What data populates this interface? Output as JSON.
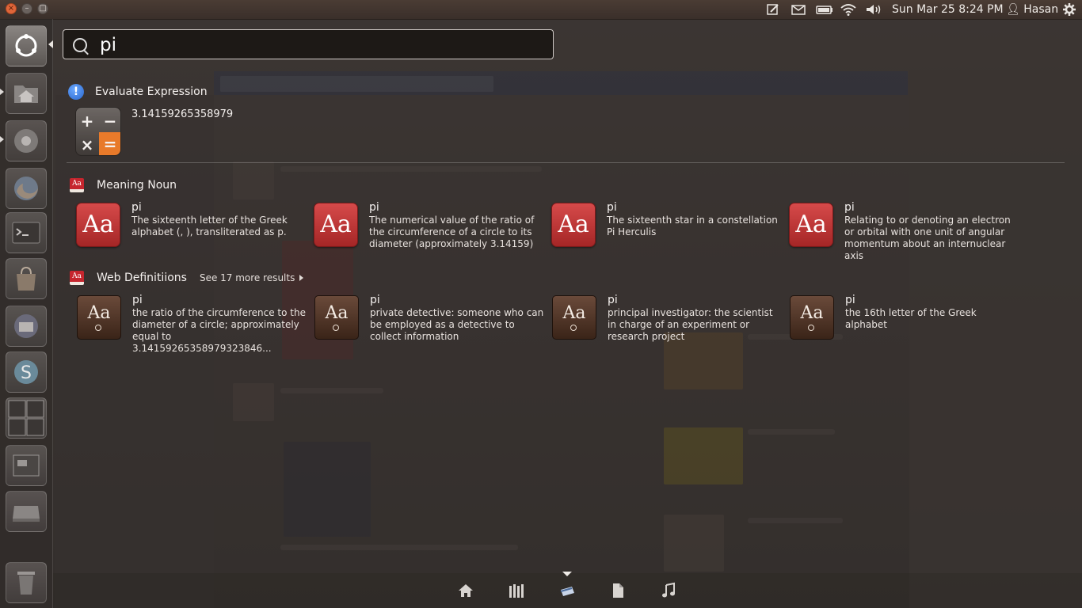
{
  "panel": {
    "clock": "Sun Mar 25  8:24 PM",
    "user": "Hasan"
  },
  "search": {
    "query": "pi"
  },
  "groups": {
    "evaluate": {
      "title": "Evaluate Expression",
      "result": "3.14159265358979"
    },
    "meaning": {
      "title": "Meaning Noun",
      "items": [
        {
          "title": "pi",
          "desc": "The sixteenth letter of the Greek alphabet (, ), transliterated as p."
        },
        {
          "title": "pi",
          "desc": "The numerical value of the ratio of the circumference of a circle to its diameter (approximately 3.14159)"
        },
        {
          "title": "pi",
          "desc": "The sixteenth star in a constellation Pi Herculis"
        },
        {
          "title": "pi",
          "desc": "Relating to or denoting an electron or orbital with one unit of angular momentum about an internuclear axis"
        }
      ]
    },
    "web": {
      "title": "Web Definitiions",
      "more": "See 17 more results",
      "items": [
        {
          "title": "pi",
          "desc": "the ratio of the circumference to the diameter of a circle; approximately equal to 3.14159265358979323846..."
        },
        {
          "title": "pi",
          "desc": "private detective: someone who can be employed as a detective to collect information"
        },
        {
          "title": "pi",
          "desc": "principal investigator: the scientist in charge of an experiment or research project"
        },
        {
          "title": "pi",
          "desc": "the 16th letter of the Greek alphabet"
        }
      ]
    }
  },
  "icons": {
    "dictionary": "Aa",
    "calc_plus": "+",
    "calc_minus": "−",
    "calc_times": "×",
    "calc_equals": "="
  },
  "colors": {
    "accent": "#e87a2a",
    "dictionary_red": "#c6262e",
    "close_button": "#e0663a"
  }
}
